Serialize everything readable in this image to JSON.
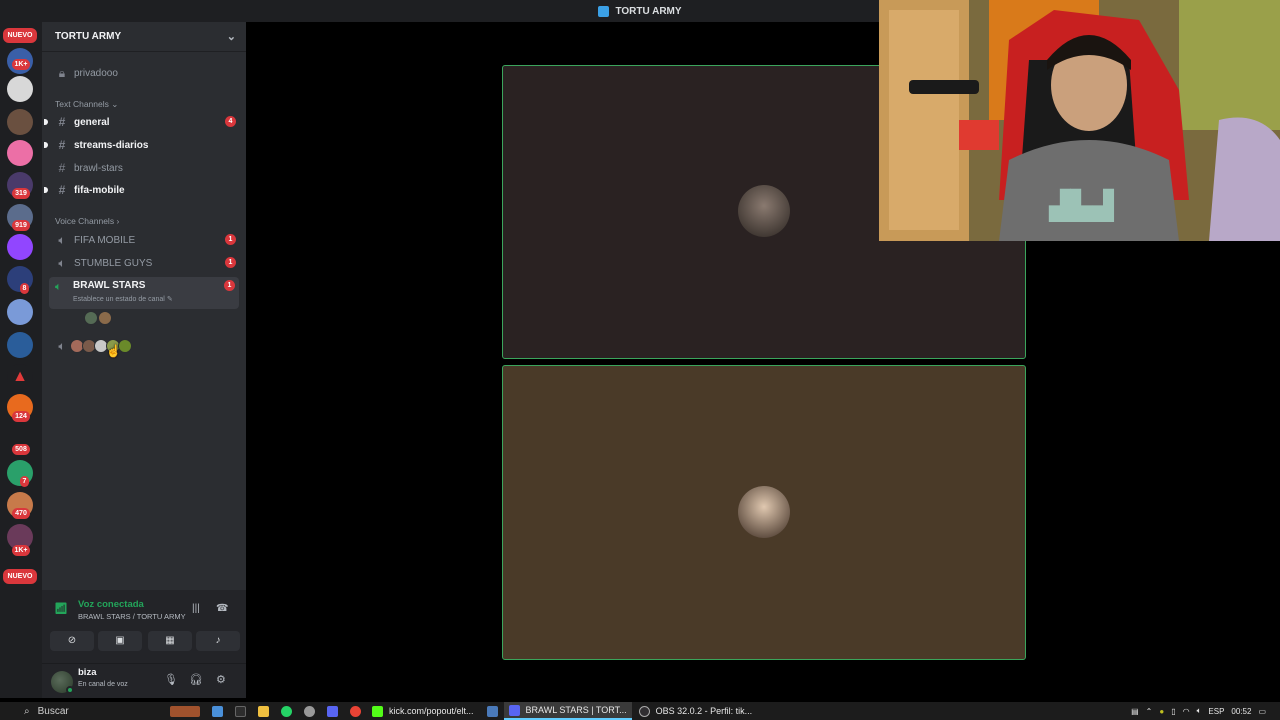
{
  "titlebar": {
    "title": "TORTU ARMY"
  },
  "rail": {
    "badges": [
      "NUEVO",
      "1K+",
      "319",
      "919",
      "8",
      "124",
      "508",
      "7",
      "470",
      "1K+",
      "NUEVO"
    ],
    "colors": {
      "mention": "#da373c",
      "background": "#1e1f22"
    }
  },
  "sidebar": {
    "server_name": "TORTU ARMY",
    "locked_channel": "privadooo",
    "text_category": "Text Channels",
    "text_channels": [
      {
        "name": "general",
        "badge": "4"
      },
      {
        "name": "streams-diarios"
      },
      {
        "name": "brawl-stars"
      },
      {
        "name": "fifa-mobile"
      }
    ],
    "voice_category": "Voice Channels",
    "voice_channels": [
      {
        "name": "FIFA MOBILE",
        "badge": "1"
      },
      {
        "name": "STUMBLE GUYS",
        "badge": "1"
      },
      {
        "name": "BRAWL STARS",
        "badge": "1",
        "status": "Establece un estado de canal"
      }
    ]
  },
  "voice_panel": {
    "title": "Voz conectada",
    "subtitle": "BRAWL STARS / TORTU ARMY"
  },
  "user_panel": {
    "name": "biza",
    "status": "En canal de voz"
  },
  "stage": {
    "tile_border": "#3ba55c"
  },
  "taskbar": {
    "search": "Buscar",
    "apps": [
      {
        "label": "kick.com/popout/elt..."
      },
      {
        "label": "BRAWL STARS | TORT..."
      },
      {
        "label": "OBS 32.0.2 - Perfil: tik..."
      }
    ],
    "lang": "ESP",
    "time": "00:52"
  }
}
